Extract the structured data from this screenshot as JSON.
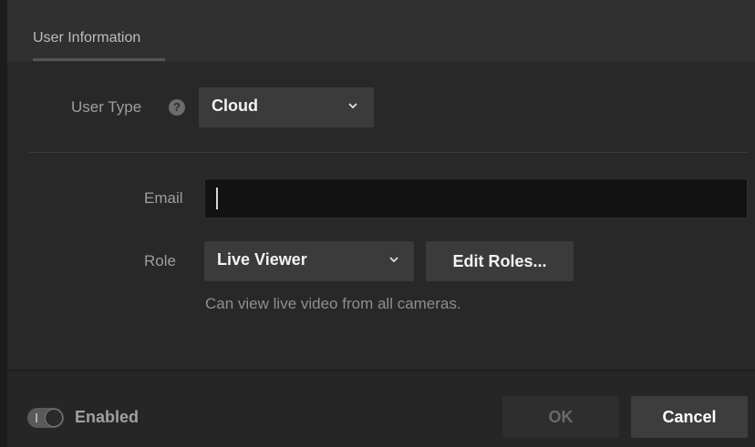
{
  "tabs": {
    "user_information": "User Information"
  },
  "user_type": {
    "label": "User Type",
    "help_glyph": "?",
    "selected": "Cloud",
    "icon": "chevron-down-icon"
  },
  "email": {
    "label": "Email",
    "value": "",
    "placeholder": ""
  },
  "role": {
    "label": "Role",
    "selected": "Live Viewer",
    "edit_button": "Edit Roles...",
    "description": "Can view live video from all cameras."
  },
  "footer": {
    "enabled_label": "Enabled",
    "enabled_state": true,
    "ok_label": "OK",
    "cancel_label": "Cancel"
  },
  "colors": {
    "background": "#282828",
    "header": "#303030",
    "input_bg": "#121212",
    "button_bg": "#3b3b3b"
  }
}
